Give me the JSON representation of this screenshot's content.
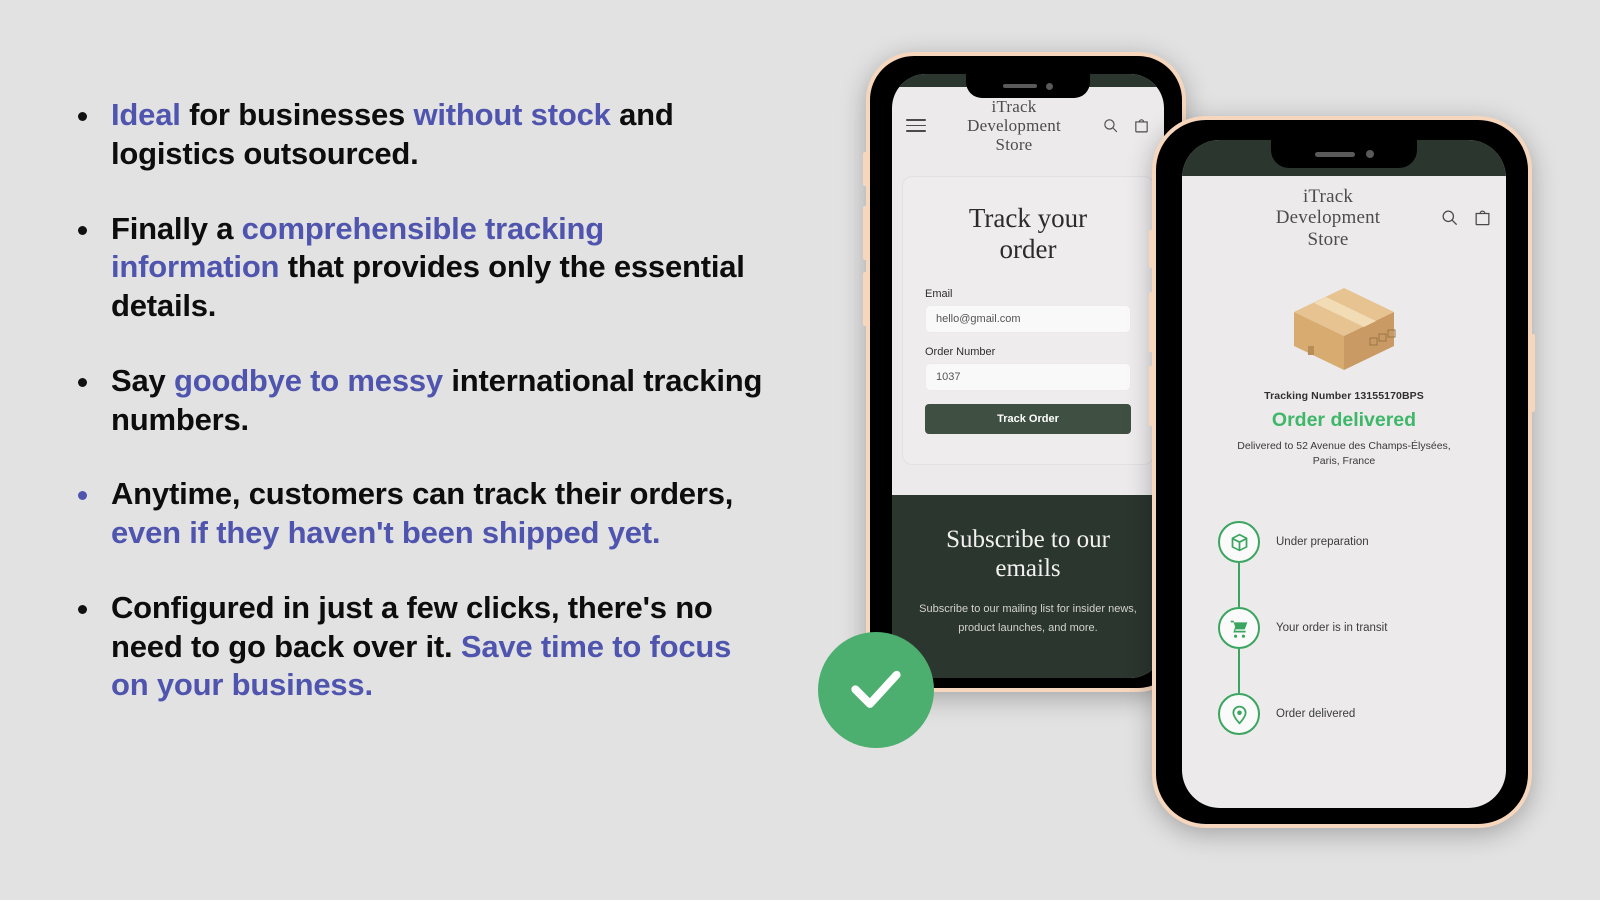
{
  "theme": {
    "background": "#e2e2e2",
    "accent_purple": "#4f55ae",
    "dark_green": "#2b362f",
    "button_green": "#3f5043",
    "success_green": "#3fb769",
    "badge_green": "#4cae6f",
    "bezel_cream": "#f6d7bd"
  },
  "bullets": [
    {
      "dot_accent": false,
      "segments": [
        {
          "text": "Ideal",
          "highlight": true
        },
        {
          "text": " for businesses ",
          "highlight": false
        },
        {
          "text": "without stock",
          "highlight": true
        },
        {
          "text": " and logistics outsourced.",
          "highlight": false
        }
      ]
    },
    {
      "dot_accent": false,
      "segments": [
        {
          "text": "Finally a ",
          "highlight": false
        },
        {
          "text": "comprehensible tracking information",
          "highlight": true
        },
        {
          "text": " that provides only the essential details.",
          "highlight": false
        }
      ]
    },
    {
      "dot_accent": false,
      "segments": [
        {
          "text": "Say ",
          "highlight": false
        },
        {
          "text": "goodbye to messy",
          "highlight": true
        },
        {
          "text": " international tracking numbers.",
          "highlight": false
        }
      ]
    },
    {
      "dot_accent": true,
      "segments": [
        {
          "text": "Anytime, customers can track their orders, ",
          "highlight": false
        },
        {
          "text": "even if they haven't been shipped yet.",
          "highlight": true
        }
      ]
    },
    {
      "dot_accent": false,
      "segments": [
        {
          "text": "Configured in just a few clicks, there's no need to go back over it. ",
          "highlight": false
        },
        {
          "text": "Save time to focus on your business.",
          "highlight": true
        }
      ]
    }
  ],
  "phone_one": {
    "header": {
      "menu_icon": "hamburger-icon",
      "store_name_lines": [
        "iTrack",
        "Development",
        "Store"
      ],
      "search_icon": "search-icon",
      "cart_icon": "shopping-bag-icon"
    },
    "track_form": {
      "title_lines": [
        "Track your",
        "order"
      ],
      "email_label": "Email",
      "email_value": "hello@gmail.com",
      "order_label": "Order Number",
      "order_value": "1037",
      "submit_label": "Track Order"
    },
    "subscribe": {
      "title_lines": [
        "Subscribe to our",
        "emails"
      ],
      "description": "Subscribe to our mailing list for insider news, product launches, and more."
    }
  },
  "phone_two": {
    "header": {
      "store_name_lines": [
        "iTrack",
        "Development",
        "Store"
      ],
      "search_icon": "search-icon",
      "cart_icon": "shopping-bag-icon"
    },
    "result": {
      "package_icon": "parcel-box-icon",
      "tracking_number": "Tracking Number 13155170BPS",
      "status": "Order delivered",
      "address_lines": [
        "Delivered to 52 Avenue des Champs-Élysées,",
        "Paris, France"
      ],
      "timeline": [
        {
          "icon": "package-icon",
          "label": "Under preparation"
        },
        {
          "icon": "shopping-cart-icon",
          "label": "Your order is in transit"
        },
        {
          "icon": "location-pin-icon",
          "label": "Order delivered"
        }
      ]
    }
  },
  "check_badge": {
    "icon": "checkmark-icon"
  }
}
